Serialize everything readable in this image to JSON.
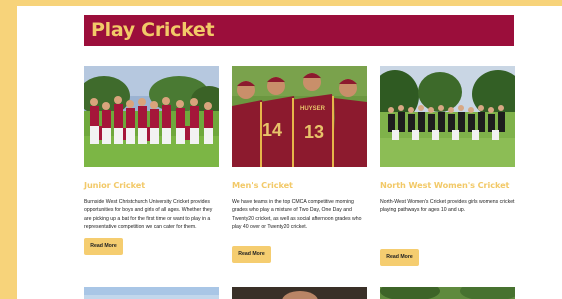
{
  "page": {
    "title": "Play Cricket",
    "colors": {
      "background": "#f7d37a",
      "banner": "#9b0e3b",
      "accent": "#f2c968"
    }
  },
  "cards": [
    {
      "title": "Junior Cricket",
      "description": "Burnside West Christchurch University Cricket provides opportunities for boys and girls of all ages. Whether they are picking up a bat for the first time or want to play in a representative competition we can cater for them.",
      "button": "Read More",
      "image": "junior-team-photo"
    },
    {
      "title": "Men's Cricket",
      "description": "We have teams in the top CMCA competitive morning grades who play a mixture of Two Day, One Day and Twenty20 cricket, as well as social afternoon grades who play 40 over or Twenty20 cricket.",
      "button": "Read More",
      "image": "mens-team-photo",
      "jersey_names": [
        "14",
        "HUYSER",
        "13"
      ]
    },
    {
      "title": "North West Women's Cricket",
      "description": "North-West Women's Cricket provides girls womens cricket playing pathways for ages 10 and up.",
      "button": "Read More",
      "image": "womens-team-photo"
    }
  ]
}
